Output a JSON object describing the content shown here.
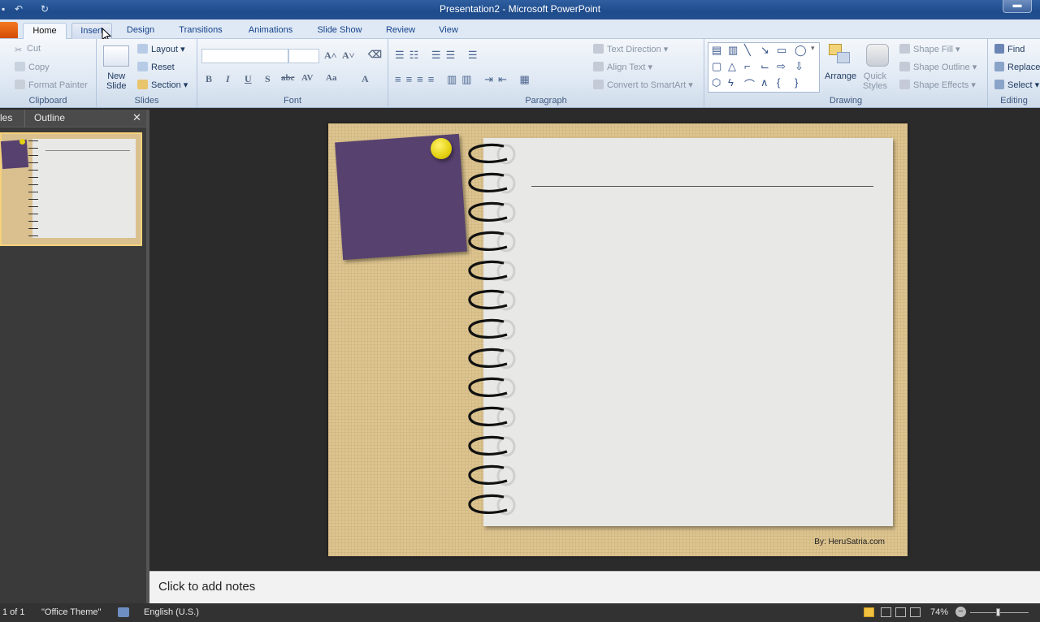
{
  "window": {
    "title": "Presentation2 - Microsoft PowerPoint",
    "minimize_label": "▬"
  },
  "quick_access": {
    "save": "▪",
    "undo": "↶",
    "redo": "↻"
  },
  "tabs": [
    {
      "label": "Home"
    },
    {
      "label": "Insert"
    },
    {
      "label": "Design"
    },
    {
      "label": "Transitions"
    },
    {
      "label": "Animations"
    },
    {
      "label": "Slide Show"
    },
    {
      "label": "Review"
    },
    {
      "label": "View"
    }
  ],
  "ribbon": {
    "clipboard": {
      "label": "Clipboard",
      "cut": "Cut",
      "copy": "Copy",
      "format_painter": "Format Painter"
    },
    "slides": {
      "label": "Slides",
      "new_slide_1": "New",
      "new_slide_2": "Slide",
      "layout": "Layout",
      "reset": "Reset",
      "section": "Section"
    },
    "font": {
      "label": "Font",
      "bold": "B",
      "italic": "I",
      "underline": "U",
      "shadow": "S",
      "strike": "abc",
      "spacing": "AV",
      "case": "Aa",
      "color": "A"
    },
    "paragraph": {
      "label": "Paragraph",
      "text_direction": "Text Direction",
      "align_text": "Align Text",
      "convert_smartart": "Convert to SmartArt"
    },
    "drawing": {
      "label": "Drawing",
      "arrange": "Arrange",
      "quick_styles_1": "Quick",
      "quick_styles_2": "Styles",
      "shape_fill": "Shape Fill",
      "shape_outline": "Shape Outline",
      "shape_effects": "Shape Effects"
    },
    "editing": {
      "label": "Editing",
      "find": "Find",
      "replace": "Replace",
      "select": "Select"
    }
  },
  "left_pane": {
    "tab_slides": "les",
    "tab_outline": "Outline",
    "close": "✕"
  },
  "slide": {
    "credit": "By: HeruSatria.com"
  },
  "notes": {
    "placeholder": "Click to add notes"
  },
  "status": {
    "slide_count": "1 of 1",
    "theme": "\"Office Theme\"",
    "language": "English (U.S.)",
    "zoom": "74%"
  }
}
